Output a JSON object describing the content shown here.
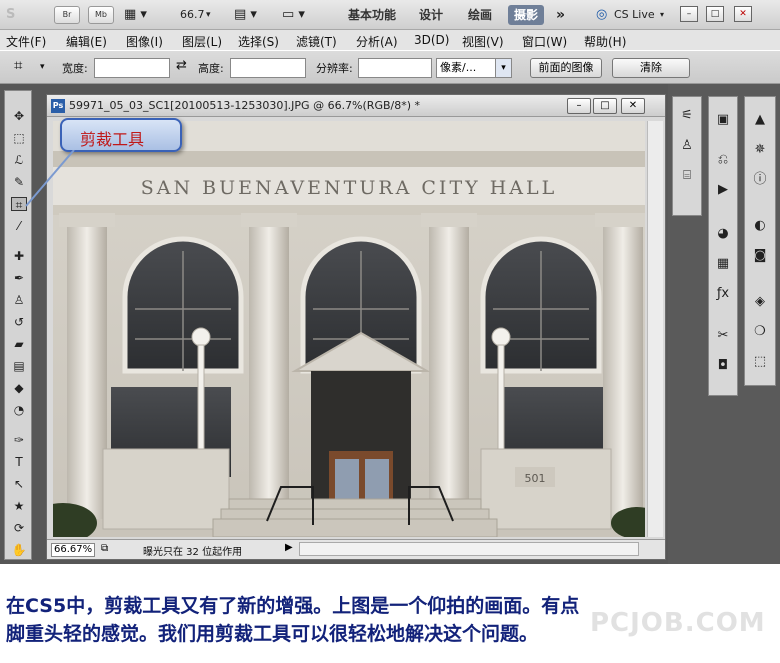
{
  "appbar": {
    "logo": "S",
    "bridge_btn": "Br",
    "minibridge_btn": "Mb",
    "zoom_value": "66.7",
    "workspaces": [
      "基本功能",
      "设计",
      "绘画",
      "摄影"
    ],
    "active_workspace": "摄影",
    "more": "»",
    "cslive": "CS Live"
  },
  "menubar": {
    "items": [
      "文件(F)",
      "编辑(E)",
      "图像(I)",
      "图层(L)",
      "选择(S)",
      "滤镜(T)",
      "分析(A)",
      "3D(D)",
      "视图(V)",
      "窗口(W)",
      "帮助(H)"
    ]
  },
  "options": {
    "width_label": "宽度:",
    "height_label": "高度:",
    "resolution_label": "分辨率:",
    "unit_select": "像素/...",
    "front_image_button": "前面的图像",
    "clear_button": "清除"
  },
  "document": {
    "title": "59971_05_03_SC1[20100513-1253030].JPG @ 66.7%(RGB/8*) *",
    "ps_badge": "Ps",
    "zoom": "66.67%",
    "status_text": "曝光只在 32 位起作用",
    "photo": {
      "building_text": "SAN BUENAVENTURA CITY HALL",
      "plaque_number": "501"
    }
  },
  "callout": {
    "text": "剪裁工具"
  },
  "caption": {
    "line1": "在CS5中，剪裁工具又有了新的增强。上图是一个仰拍的画面。有点",
    "line2": "脚重头轻的感觉。我们用剪裁工具可以很轻松地解决这个问题。"
  },
  "watermark": "PCJOB.COM"
}
